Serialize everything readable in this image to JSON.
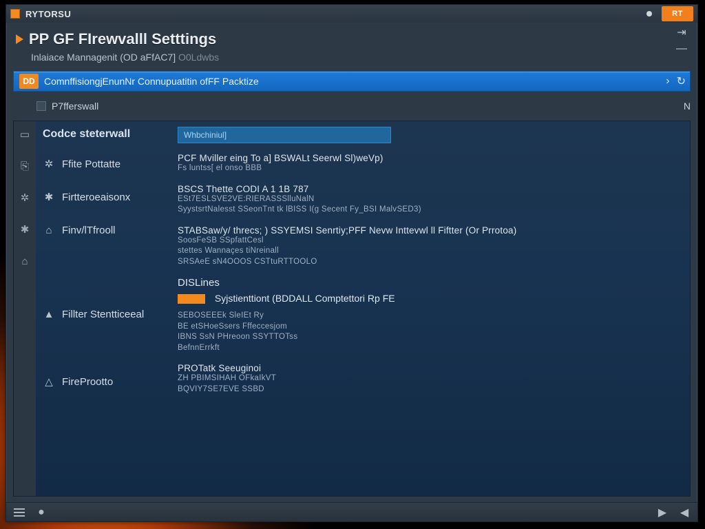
{
  "window": {
    "title": "RYTORSU",
    "close_label": "RT"
  },
  "header": {
    "page_title": "PP GF FIrewvalll Setttings",
    "subtitle_main": "Inlaiace Mannagenit (OD aFfAC7]",
    "subtitle_muted": "O0Ldwbs"
  },
  "breadcrumb": {
    "badge": "DD",
    "text": "ComnffisiongjEnunNr Connupuatitin ofFF Packtize"
  },
  "toolstrip": {
    "left": "P7fferswall",
    "right": "N"
  },
  "sidebar": {
    "heading": "Codce steterwall",
    "items": [
      {
        "icon": "gear-icon",
        "label": "Ffite Pottatte"
      },
      {
        "icon": "asterisk-icon",
        "label": "Firtteroeaisonx"
      },
      {
        "icon": "home-icon",
        "label": "Finv/lTfrooll"
      },
      {
        "icon": "fire-icon",
        "label": "Fillter Stentticeeal"
      },
      {
        "icon": "upload-icon",
        "label": "FireProotto"
      }
    ]
  },
  "content": {
    "input_value": "Whbchiniul]",
    "blocks": [
      {
        "head": "PCF Mviller eing To a] BSWALt Seerwl Sl)weVp)",
        "lines": [
          "Fs luntss[ el onso BBB"
        ]
      },
      {
        "head": "BSCS Thette CODI A 1 1B 787",
        "lines": [
          "ESt7ESLSVE2VE:RIERASSSlluNalN",
          "SyystsrtNalesst SSeonTnt tk lBISS I(g Secent Fy_BSI MalvSED3)"
        ]
      },
      {
        "head": "STABSaw/y/ threcs; ) SSYEMSI Senrtiy;PFF Nevw Inttevwl ll Fiftter (Or Prrotoa)",
        "lines": [
          "SoosFeSB SSpfattCesl",
          "stettes Wannaçes tiNreinall",
          "SRSAeE sN4OOOS CSTtuRTTOOLO"
        ]
      }
    ],
    "section_label": "DISLines",
    "section_row": "Syjstienttiont (BDDALL Comptettori Rp FE",
    "block2": {
      "lines": [
        "SEBOSEEEk SleIEt Ry",
        "BE etSHoeSsers Fffeccesjom",
        "IBNS SsN PHreoon SSYTTOTss",
        "BefnnErrkft"
      ]
    },
    "block3": {
      "head": "PROTatk Seeuginoi",
      "lines": [
        "ZH PBIMSIHAH  OFkaIkVT",
        "BQVIY7SE7EVE SSBD"
      ]
    }
  },
  "rail_icons": [
    "doc-icon",
    "plug-icon",
    "gear-icon",
    "asterisk-icon",
    "home-icon"
  ],
  "status_icons": [
    "menu-icon",
    "dot-icon",
    "play-left-icon",
    "play-icon"
  ]
}
